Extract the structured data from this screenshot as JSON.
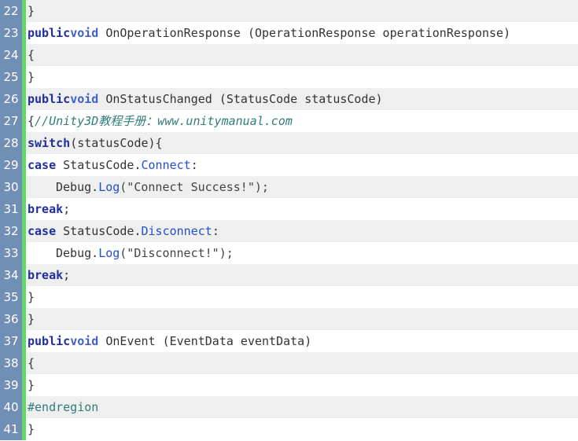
{
  "lines": [
    {
      "num": "22",
      "parts": [
        {
          "t": "}",
          "c": "punct"
        }
      ]
    },
    {
      "num": "23",
      "parts": [
        {
          "t": "public",
          "c": "kw"
        },
        {
          "t": "void",
          "c": "kw2"
        },
        {
          "t": " OnOperationResponse (OperationResponse operationResponse)",
          "c": "punct"
        }
      ]
    },
    {
      "num": "24",
      "parts": [
        {
          "t": "{",
          "c": "punct"
        }
      ]
    },
    {
      "num": "25",
      "parts": [
        {
          "t": "}",
          "c": "punct"
        }
      ]
    },
    {
      "num": "26",
      "parts": [
        {
          "t": "public",
          "c": "kw"
        },
        {
          "t": "void",
          "c": "kw2"
        },
        {
          "t": " OnStatusChanged (StatusCode statusCode)",
          "c": "punct"
        }
      ]
    },
    {
      "num": "27",
      "parts": [
        {
          "t": "{",
          "c": "punct"
        },
        {
          "t": "//Unity3D教程手册：www.unitymanual.com",
          "c": "comment"
        }
      ]
    },
    {
      "num": "28",
      "parts": [
        {
          "t": "switch",
          "c": "kw"
        },
        {
          "t": "(statusCode){",
          "c": "punct"
        }
      ]
    },
    {
      "num": "29",
      "parts": [
        {
          "t": "case",
          "c": "kw"
        },
        {
          "t": " StatusCode.",
          "c": "punct"
        },
        {
          "t": "Connect",
          "c": "prop"
        },
        {
          "t": ":",
          "c": "punct"
        }
      ]
    },
    {
      "num": "30",
      "indent": true,
      "parts": [
        {
          "t": "Debug.",
          "c": "punct"
        },
        {
          "t": "Log",
          "c": "method"
        },
        {
          "t": "(\"Connect Success!\");",
          "c": "str"
        }
      ]
    },
    {
      "num": "31",
      "parts": [
        {
          "t": "break",
          "c": "kw"
        },
        {
          "t": ";",
          "c": "punct"
        }
      ]
    },
    {
      "num": "32",
      "parts": [
        {
          "t": "case",
          "c": "kw"
        },
        {
          "t": " StatusCode.",
          "c": "punct"
        },
        {
          "t": "Disconnect",
          "c": "prop"
        },
        {
          "t": ":",
          "c": "punct"
        }
      ]
    },
    {
      "num": "33",
      "indent": true,
      "parts": [
        {
          "t": "Debug.",
          "c": "punct"
        },
        {
          "t": "Log",
          "c": "method"
        },
        {
          "t": "(\"Disconnect!\");",
          "c": "str"
        }
      ]
    },
    {
      "num": "34",
      "parts": [
        {
          "t": "break",
          "c": "kw"
        },
        {
          "t": ";",
          "c": "punct"
        }
      ]
    },
    {
      "num": "35",
      "parts": [
        {
          "t": "}",
          "c": "punct"
        }
      ]
    },
    {
      "num": "36",
      "parts": [
        {
          "t": "}",
          "c": "punct"
        }
      ]
    },
    {
      "num": "37",
      "parts": [
        {
          "t": "public",
          "c": "kw"
        },
        {
          "t": "void",
          "c": "kw2"
        },
        {
          "t": " OnEvent (EventData eventData)",
          "c": "punct"
        }
      ]
    },
    {
      "num": "38",
      "parts": [
        {
          "t": "{",
          "c": "punct"
        }
      ]
    },
    {
      "num": "39",
      "parts": [
        {
          "t": "}",
          "c": "punct"
        }
      ]
    },
    {
      "num": "40",
      "parts": [
        {
          "t": "#endregion",
          "c": "dir"
        }
      ]
    },
    {
      "num": "41",
      "parts": [
        {
          "t": "}",
          "c": "punct"
        }
      ]
    }
  ],
  "colors": {
    "gutter_bg": "#6f8fb4",
    "gutter_border": "#63d669",
    "alt_row": "#efefef",
    "keyword": "#1f2fa0",
    "type_keyword": "#3f5fd2",
    "member": "#1f4fd0",
    "comment": "#2f7c7c"
  }
}
